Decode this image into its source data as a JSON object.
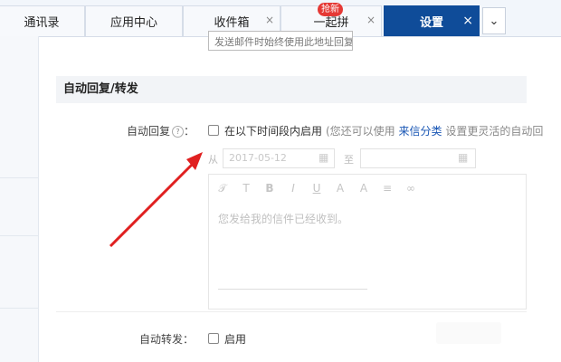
{
  "tabs": [
    {
      "label": "通讯录"
    },
    {
      "label": "应用中心"
    },
    {
      "label": "收件箱",
      "close": "×"
    },
    {
      "label": "一起拼",
      "close": "×",
      "badge": "抢新"
    },
    {
      "label": "设置",
      "close": "×"
    }
  ],
  "tab_menu_icon": "⌄",
  "top_field_value": "发送邮件时始终使用此地址回复",
  "section_title": "自动回复/转发",
  "auto_reply": {
    "label": "自动回复",
    "help_icon": "?",
    "colon": "：",
    "checkbox_label": "在以下时间段内启用",
    "hint_prefix": "(您还可以使用",
    "hint_link": "来信分类",
    "hint_suffix": "设置更灵活的自动回",
    "from_label": "从",
    "start_date": "2017-05-12",
    "to_label": "至",
    "end_date": "",
    "editor_placeholder": "您发给我的信件已经收到。"
  },
  "auto_forward": {
    "label": "自动转发：",
    "checkbox_label": "启用"
  },
  "accent": "#0f4c99",
  "annotation_color": "#e02020"
}
